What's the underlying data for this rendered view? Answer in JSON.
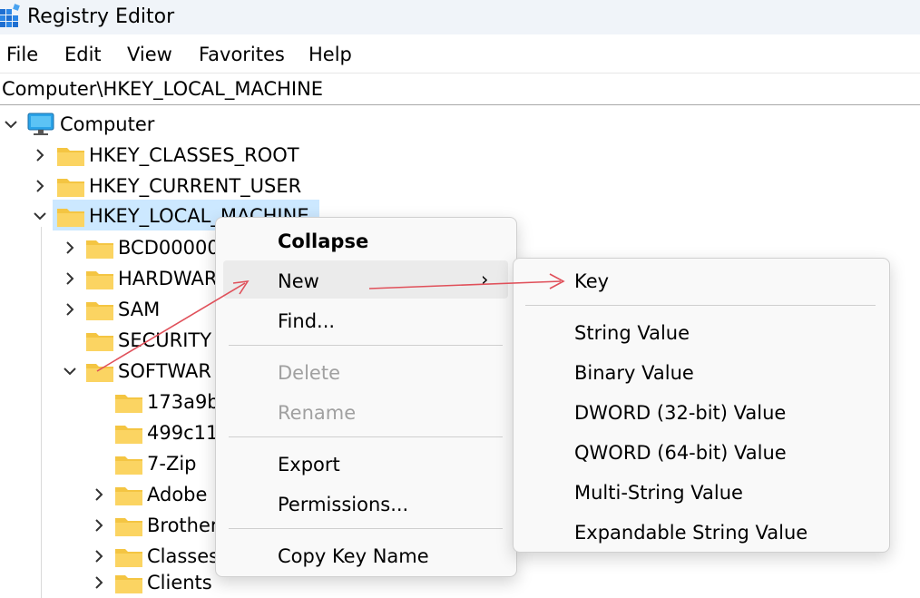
{
  "window": {
    "title": "Registry Editor",
    "icon": "registry-editor-icon"
  },
  "menubar": [
    "File",
    "Edit",
    "View",
    "Favorites",
    "Help"
  ],
  "address": "Computer\\HKEY_LOCAL_MACHINE",
  "tree": {
    "root": "Computer",
    "hives": [
      "HKEY_CLASSES_ROOT",
      "HKEY_CURRENT_USER",
      "HKEY_LOCAL_MACHINE"
    ],
    "hklm_children": [
      "BCD00000",
      "HARDWAR",
      "SAM",
      "SECURITY",
      "SOFTWAR"
    ],
    "software_children": [
      "173a9b",
      "499c11",
      "7-Zip",
      "Adobe",
      "Brother",
      "Classes",
      "Clients"
    ]
  },
  "context_menu": {
    "items": [
      "Collapse",
      "New",
      "Find...",
      "Delete",
      "Rename",
      "Export",
      "Permissions...",
      "Copy Key Name"
    ],
    "submenu_arrow": "›"
  },
  "submenu": {
    "items": [
      "Key",
      "String Value",
      "Binary Value",
      "DWORD (32-bit) Value",
      "QWORD (64-bit) Value",
      "Multi-String Value",
      "Expandable String Value"
    ]
  },
  "colors": {
    "selection": "#cce8ff",
    "folder": "#f4c542",
    "arrow": "#e0505a",
    "disabled": "#a0a0a0"
  }
}
